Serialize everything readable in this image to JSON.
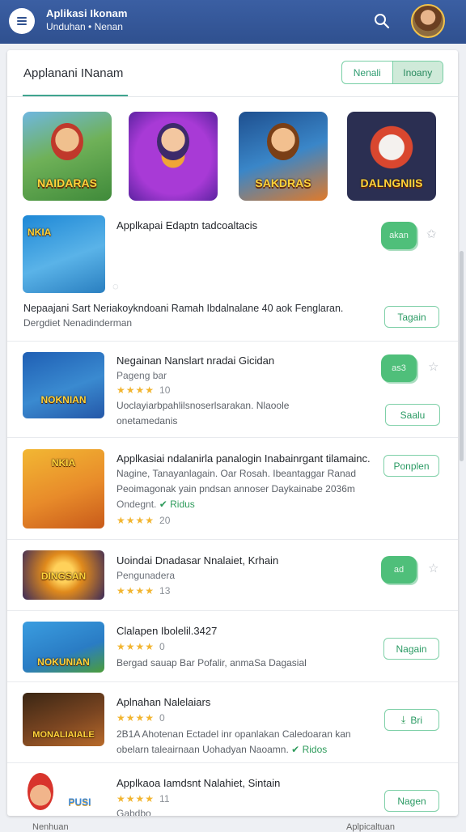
{
  "header": {
    "title": "Aplikasi Ikonam",
    "subtitle": "Unduhan • Nenan",
    "menu_icon": "menu-icon",
    "search_icon": "search-icon"
  },
  "section": {
    "title": "Applanani INanam",
    "segments": [
      "Nenali",
      "Inoany"
    ],
    "active_segment": 1
  },
  "featured": [
    {
      "label": "NAIDARAS",
      "bg": "#4c9a4a"
    },
    {
      "label": "",
      "bg": "#7a32c6"
    },
    {
      "label": "SAKDRAS",
      "bg": "#2c6db4"
    },
    {
      "label": "DALNGNIIS",
      "bg": "#222640"
    }
  ],
  "rows": [
    {
      "title": "Applkapai Edaptn tadcoaltacis",
      "desc1": "Nepaajani Sart Neriakoykndoani Ramah Ibdalnalane 40 aok Fenglaran.",
      "desc2": "Dergdiet Nenadinderman",
      "thumb_label": "NKIA",
      "thumb_bg": "#2a7fc0",
      "pill_label": "akan",
      "button": "Tagain"
    },
    {
      "title": "Negainan Nanslart nradai Gicidan",
      "sub": "Pageng bar",
      "rating": "10",
      "desc1": "Uoclayiarbpahlilsnoserlsarakan. Nlaoole",
      "desc2": "onetamedanis",
      "thumb_label": "NOKNIAN",
      "thumb_bg": "#2457a8",
      "pill_label": "as3",
      "button": "Saalu"
    },
    {
      "title": "Applkasiai ndalanirla panalogin Inabainrgant tilamainc.",
      "desc1": "Nagine, Tanayanlagain. Oar Rosah. Ibeantaggar Ranad",
      "desc2": "Peoimagonak yain pndsan annoser Daykainabe 2036m",
      "sub": "Ondegnt.",
      "verified": "Ridus",
      "rating": "20",
      "thumb_label": "NKIA",
      "thumb_bg": "#e5892a",
      "button": "Ponplen"
    },
    {
      "title": "Uoindai Dnadasar Nnalaiet, Krhain",
      "sub": "Pengunadera",
      "rating": "13",
      "thumb_label": "DINGSAN",
      "thumb_bg": "#c97a1b",
      "pill_label": "ad",
      "button": ""
    },
    {
      "title": "Clalapen Ibolelil.3427",
      "rating": "0",
      "desc1": "Bergad sauap Bar Pofalir, anmaSa Dagasial",
      "thumb_label": "NOKUNIAN",
      "thumb_bg": "#2d7fc7",
      "button": "Nagain"
    },
    {
      "title": "Aplnahan Nalelaiars",
      "rating": "0",
      "desc1": "2B1A Ahotenan Ectadel inr opanlakan Caledoaran kan",
      "desc2": "obelarn taleairnaan Uohadyan Naoamn.",
      "verified": "Ridos",
      "thumb_label": "MONALIAIALE",
      "thumb_bg": "#6b3b1e",
      "button": "Bri"
    },
    {
      "title": "Applkaoa Iamdsnt Nalahiet, Sintain",
      "rating": "11",
      "sub": "Gabdbo",
      "thumb_label": "PUSI",
      "thumb_bg": "#f5f5f5",
      "button": "Nagen"
    }
  ],
  "bottom": [
    "Nenhuan",
    "Aplpicaltuan"
  ],
  "colors": {
    "header": "#3456a0",
    "accent": "#3fa58f",
    "star": "#f2b530"
  }
}
